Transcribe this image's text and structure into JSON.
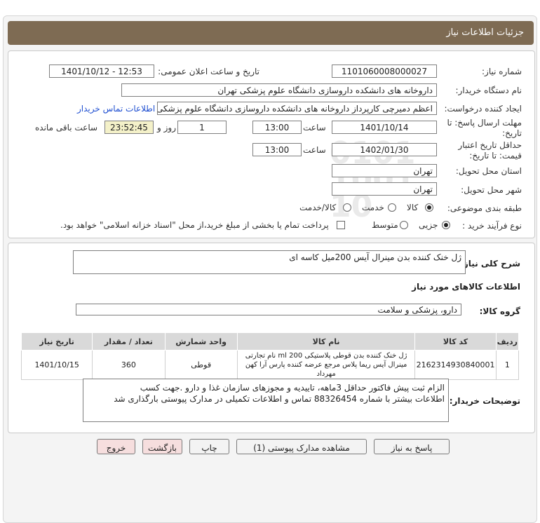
{
  "header": {
    "title": "جزئیات اطلاعات نیاز"
  },
  "fields": {
    "need_number_label": "شماره نیاز:",
    "need_number": "1101060008000027",
    "announce_label": "تاریخ و ساعت اعلان عمومی:",
    "announce_value": "1401/10/12 - 12:53",
    "buyer_label": "نام دستگاه خریدار:",
    "buyer_value": "داروخانه های دانشکده داروسازی دانشگاه علوم پزشکی تهران",
    "creator_label": "ایجاد کننده درخواست:",
    "creator_value": "اعظم دمیرچی کارپرداز داروخانه های دانشکده داروسازی دانشگاه علوم پزشکی",
    "contact_link": "اطلاعات تماس خریدار",
    "deadline_label_1": "مهلت ارسال پاسخ: تا",
    "deadline_label_2": "تاریخ:",
    "deadline_date": "1401/10/14",
    "time_label": "ساعت",
    "deadline_time": "13:00",
    "days_value": "1",
    "days_label": "روز و",
    "remaining_time": "23:52:45",
    "remaining_label": "ساعت باقی مانده",
    "validity_label_1": "حداقل تاریخ اعتبار",
    "validity_label_2": "قیمت: تا تاریخ:",
    "validity_date": "1402/01/30",
    "validity_time_label": "ساعت",
    "validity_time": "13:00",
    "province_label": "استان محل تحویل:",
    "province_value": "تهران",
    "city_label": "شهر محل تحویل:",
    "city_value": "تهران",
    "category_label": "طبقه بندی موضوعی:",
    "category_options": [
      "کالا",
      "خدمت",
      "کالا/خدمت"
    ],
    "process_label": "نوع فرآیند خرید :",
    "process_options": [
      "جزیی",
      "متوسط"
    ],
    "payment_note": "پرداخت تمام یا بخشی از مبلغ خرید،از محل \"اسناد خزانه اسلامی\" خواهد بود."
  },
  "summary": {
    "label": "شرح کلی نیاز:",
    "value": "ژل خنک کننده بدن مینرال آیس 200میل کاسه ای"
  },
  "goods": {
    "section_title": "اطلاعات کالاهای مورد نیاز",
    "group_label": "گروه کالا:",
    "group_value": "دارو، پزشکی و سلامت"
  },
  "table": {
    "headers": [
      "ردیف",
      "کد کالا",
      "نام کالا",
      "واحد شمارش",
      "تعداد / مقدار",
      "تاریخ نیاز"
    ],
    "rows": [
      {
        "row": "1",
        "code": "2162314930840001",
        "name_line1": "ژل خنک کننده بدن قوطی پلاستیکی 200 ml نام تجارتی",
        "name_line2": "مینرال آیس ریما پلاس مرجع عرضه کننده پارس آرا کهن مهرداد",
        "unit": "قوطی",
        "qty": "360",
        "date": "1401/10/15"
      }
    ]
  },
  "buyer_notes": {
    "label": "توضیحات خریدار:",
    "line1": "الزام ثبت پیش فاکتور حداقل 3ماهه، تاییدیه و مجوزهای سازمان غذا و دارو .جهت کسب",
    "line2": "اطلاعات بیشتر با شماره 88326454 تماس و اطلاعات تکمیلی در مدارک پیوستی بارگذاری شد"
  },
  "buttons": {
    "reply": "پاسخ به نیاز",
    "attachments": "مشاهده مدارک پیوستی (1)",
    "print": "چاپ",
    "back": "بازگشت",
    "exit": "خروج"
  },
  "watermark": {
    "brand": "ParsNamadData",
    "line1": "پایگاه اطلاع رسانی مناقصات و مزایده",
    "line2": "فراوری اطلاعات پارس نماد داده ها",
    "digits": "0101 1001 10"
  }
}
